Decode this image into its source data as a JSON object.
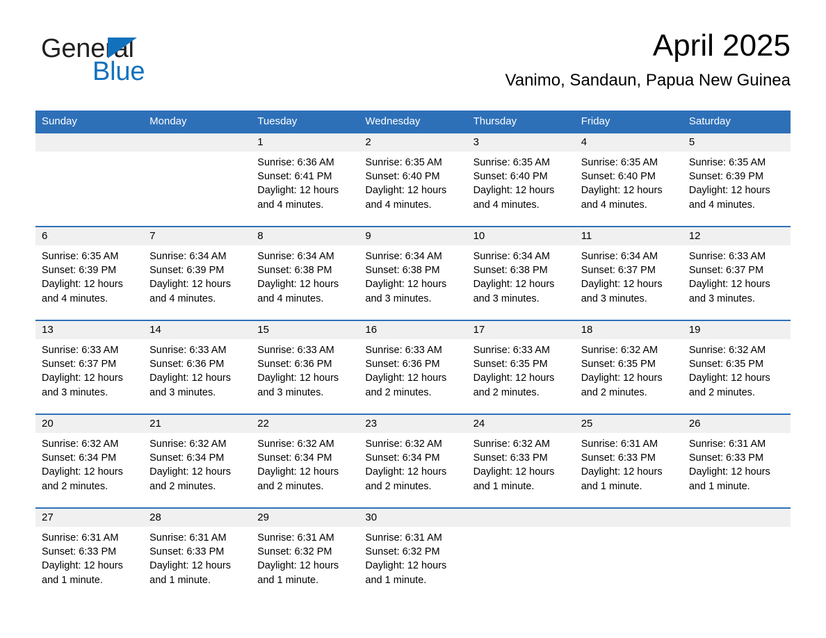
{
  "brand": {
    "name_part1": "General",
    "name_part2": "Blue",
    "icon": "triangle-logo-icon",
    "colors": {
      "black": "#221f1f",
      "blue": "#1271bd"
    }
  },
  "header": {
    "month_title": "April 2025",
    "location": "Vanimo, Sandaun, Papua New Guinea"
  },
  "theme": {
    "header_blue": "#2e70b8",
    "row_divider_blue": "#2e70b8",
    "daynum_band_gray": "#f0f0f0",
    "cell_white": "#ffffff"
  },
  "calendar": {
    "weekday_headers": [
      "Sunday",
      "Monday",
      "Tuesday",
      "Wednesday",
      "Thursday",
      "Friday",
      "Saturday"
    ],
    "weeks": [
      [
        {
          "day": "",
          "sunrise": "",
          "sunset": "",
          "daylight": "",
          "empty": true
        },
        {
          "day": "",
          "sunrise": "",
          "sunset": "",
          "daylight": "",
          "empty": true
        },
        {
          "day": "1",
          "sunrise": "Sunrise: 6:36 AM",
          "sunset": "Sunset: 6:41 PM",
          "daylight": "Daylight: 12 hours and 4 minutes."
        },
        {
          "day": "2",
          "sunrise": "Sunrise: 6:35 AM",
          "sunset": "Sunset: 6:40 PM",
          "daylight": "Daylight: 12 hours and 4 minutes."
        },
        {
          "day": "3",
          "sunrise": "Sunrise: 6:35 AM",
          "sunset": "Sunset: 6:40 PM",
          "daylight": "Daylight: 12 hours and 4 minutes."
        },
        {
          "day": "4",
          "sunrise": "Sunrise: 6:35 AM",
          "sunset": "Sunset: 6:40 PM",
          "daylight": "Daylight: 12 hours and 4 minutes."
        },
        {
          "day": "5",
          "sunrise": "Sunrise: 6:35 AM",
          "sunset": "Sunset: 6:39 PM",
          "daylight": "Daylight: 12 hours and 4 minutes."
        }
      ],
      [
        {
          "day": "6",
          "sunrise": "Sunrise: 6:35 AM",
          "sunset": "Sunset: 6:39 PM",
          "daylight": "Daylight: 12 hours and 4 minutes."
        },
        {
          "day": "7",
          "sunrise": "Sunrise: 6:34 AM",
          "sunset": "Sunset: 6:39 PM",
          "daylight": "Daylight: 12 hours and 4 minutes."
        },
        {
          "day": "8",
          "sunrise": "Sunrise: 6:34 AM",
          "sunset": "Sunset: 6:38 PM",
          "daylight": "Daylight: 12 hours and 4 minutes."
        },
        {
          "day": "9",
          "sunrise": "Sunrise: 6:34 AM",
          "sunset": "Sunset: 6:38 PM",
          "daylight": "Daylight: 12 hours and 3 minutes."
        },
        {
          "day": "10",
          "sunrise": "Sunrise: 6:34 AM",
          "sunset": "Sunset: 6:38 PM",
          "daylight": "Daylight: 12 hours and 3 minutes."
        },
        {
          "day": "11",
          "sunrise": "Sunrise: 6:34 AM",
          "sunset": "Sunset: 6:37 PM",
          "daylight": "Daylight: 12 hours and 3 minutes."
        },
        {
          "day": "12",
          "sunrise": "Sunrise: 6:33 AM",
          "sunset": "Sunset: 6:37 PM",
          "daylight": "Daylight: 12 hours and 3 minutes."
        }
      ],
      [
        {
          "day": "13",
          "sunrise": "Sunrise: 6:33 AM",
          "sunset": "Sunset: 6:37 PM",
          "daylight": "Daylight: 12 hours and 3 minutes."
        },
        {
          "day": "14",
          "sunrise": "Sunrise: 6:33 AM",
          "sunset": "Sunset: 6:36 PM",
          "daylight": "Daylight: 12 hours and 3 minutes."
        },
        {
          "day": "15",
          "sunrise": "Sunrise: 6:33 AM",
          "sunset": "Sunset: 6:36 PM",
          "daylight": "Daylight: 12 hours and 3 minutes."
        },
        {
          "day": "16",
          "sunrise": "Sunrise: 6:33 AM",
          "sunset": "Sunset: 6:36 PM",
          "daylight": "Daylight: 12 hours and 2 minutes."
        },
        {
          "day": "17",
          "sunrise": "Sunrise: 6:33 AM",
          "sunset": "Sunset: 6:35 PM",
          "daylight": "Daylight: 12 hours and 2 minutes."
        },
        {
          "day": "18",
          "sunrise": "Sunrise: 6:32 AM",
          "sunset": "Sunset: 6:35 PM",
          "daylight": "Daylight: 12 hours and 2 minutes."
        },
        {
          "day": "19",
          "sunrise": "Sunrise: 6:32 AM",
          "sunset": "Sunset: 6:35 PM",
          "daylight": "Daylight: 12 hours and 2 minutes."
        }
      ],
      [
        {
          "day": "20",
          "sunrise": "Sunrise: 6:32 AM",
          "sunset": "Sunset: 6:34 PM",
          "daylight": "Daylight: 12 hours and 2 minutes."
        },
        {
          "day": "21",
          "sunrise": "Sunrise: 6:32 AM",
          "sunset": "Sunset: 6:34 PM",
          "daylight": "Daylight: 12 hours and 2 minutes."
        },
        {
          "day": "22",
          "sunrise": "Sunrise: 6:32 AM",
          "sunset": "Sunset: 6:34 PM",
          "daylight": "Daylight: 12 hours and 2 minutes."
        },
        {
          "day": "23",
          "sunrise": "Sunrise: 6:32 AM",
          "sunset": "Sunset: 6:34 PM",
          "daylight": "Daylight: 12 hours and 2 minutes."
        },
        {
          "day": "24",
          "sunrise": "Sunrise: 6:32 AM",
          "sunset": "Sunset: 6:33 PM",
          "daylight": "Daylight: 12 hours and 1 minute."
        },
        {
          "day": "25",
          "sunrise": "Sunrise: 6:31 AM",
          "sunset": "Sunset: 6:33 PM",
          "daylight": "Daylight: 12 hours and 1 minute."
        },
        {
          "day": "26",
          "sunrise": "Sunrise: 6:31 AM",
          "sunset": "Sunset: 6:33 PM",
          "daylight": "Daylight: 12 hours and 1 minute."
        }
      ],
      [
        {
          "day": "27",
          "sunrise": "Sunrise: 6:31 AM",
          "sunset": "Sunset: 6:33 PM",
          "daylight": "Daylight: 12 hours and 1 minute."
        },
        {
          "day": "28",
          "sunrise": "Sunrise: 6:31 AM",
          "sunset": "Sunset: 6:33 PM",
          "daylight": "Daylight: 12 hours and 1 minute."
        },
        {
          "day": "29",
          "sunrise": "Sunrise: 6:31 AM",
          "sunset": "Sunset: 6:32 PM",
          "daylight": "Daylight: 12 hours and 1 minute."
        },
        {
          "day": "30",
          "sunrise": "Sunrise: 6:31 AM",
          "sunset": "Sunset: 6:32 PM",
          "daylight": "Daylight: 12 hours and 1 minute."
        },
        {
          "day": "",
          "sunrise": "",
          "sunset": "",
          "daylight": "",
          "empty": true
        },
        {
          "day": "",
          "sunrise": "",
          "sunset": "",
          "daylight": "",
          "empty": true
        },
        {
          "day": "",
          "sunrise": "",
          "sunset": "",
          "daylight": "",
          "empty": true
        }
      ]
    ]
  }
}
